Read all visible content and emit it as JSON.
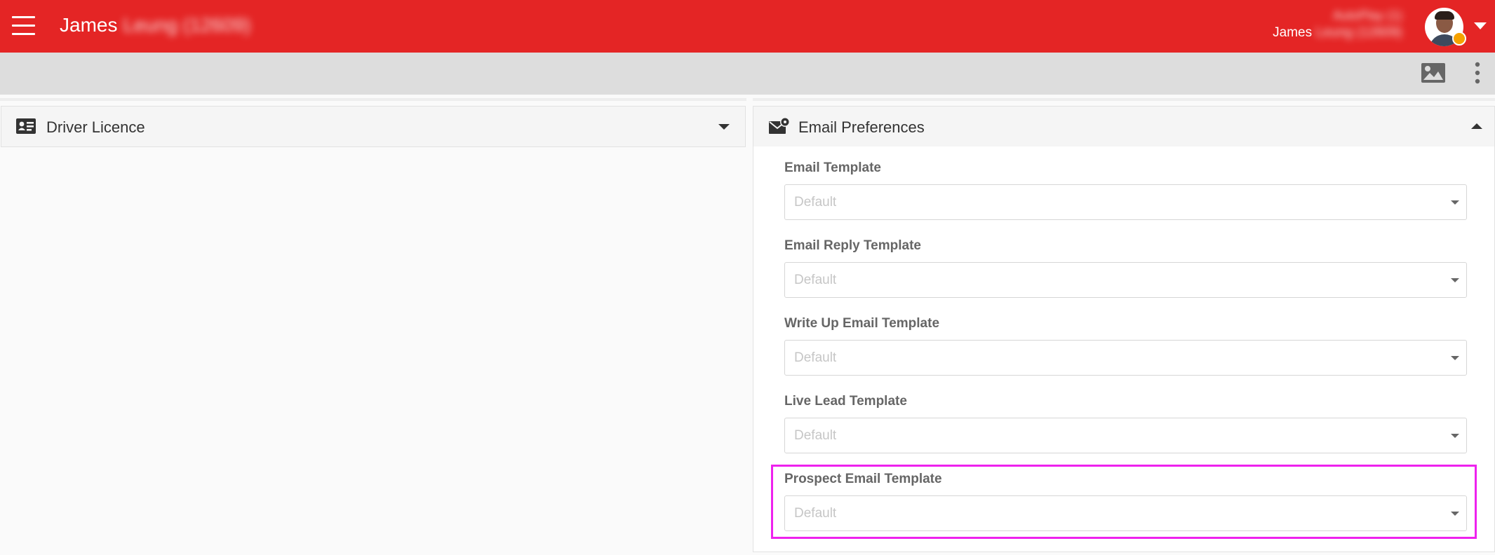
{
  "header": {
    "title_name": "James",
    "title_redacted": "Leung (12609)",
    "user_line1_redacted": "AutoPlay (1)",
    "user_line2_name": "James",
    "user_line2_redacted": "Leung (12609)",
    "menu_icon": "hamburger-menu-icon",
    "status_color": "#f5a100",
    "brand_color": "#e42525"
  },
  "toolbar": {
    "image_icon": "image-icon",
    "more_icon": "more-vertical-icon"
  },
  "panels": {
    "driver_licence": {
      "title": "Driver Licence",
      "icon": "id-card-icon"
    },
    "email_preferences": {
      "title": "Email Preferences",
      "icon": "email-settings-icon"
    }
  },
  "fields": [
    {
      "label": "Email Template",
      "value": "Default"
    },
    {
      "label": "Email Reply Template",
      "value": "Default"
    },
    {
      "label": "Write Up Email Template",
      "value": "Default"
    },
    {
      "label": "Live Lead Template",
      "value": "Default"
    },
    {
      "label": "Prospect Email Template",
      "value": "Default"
    }
  ],
  "highlight_color": "#ee22ee"
}
